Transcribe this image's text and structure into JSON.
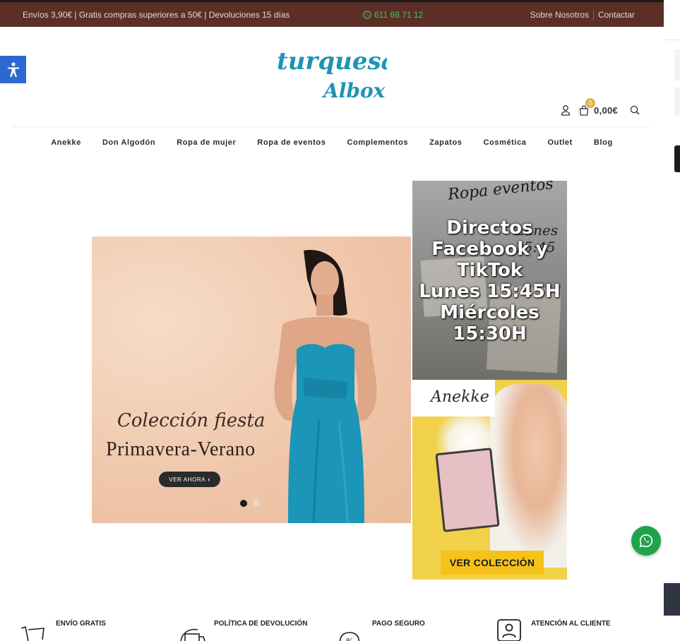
{
  "topbar": {
    "promo_text": "Envíos 3,90€ | Gratis compras superiores a 50€ | Devoluciones 15 días",
    "phone": "611 68 71 12",
    "links": [
      "Sobre Nosotros",
      "Contactar"
    ]
  },
  "logo": {
    "line1": "turquesa",
    "line2": "Albox"
  },
  "header": {
    "cart_count": "0",
    "cart_total": "0,00€"
  },
  "nav": [
    "Anekke",
    "Don Algodón",
    "Ropa de mujer",
    "Ropa de eventos",
    "Complementos",
    "Zapatos",
    "Cosmética",
    "Outlet",
    "Blog"
  ],
  "hero": {
    "title_script": "Colección fiesta",
    "title_serif": "Primavera-Verano",
    "button": "VER AHORA",
    "slides": 2,
    "active_slide": 1
  },
  "promo_live": {
    "script_top": "Ropa eventos",
    "script_side": "Lunes 15:45",
    "lines": [
      "Directos",
      "Facebook y",
      "TikTok",
      "Lunes 15:45H",
      "Miércoles",
      "15:30H"
    ]
  },
  "promo_anekke": {
    "brand": "Anekke",
    "cta": "VER COLECCIÓN"
  },
  "features": [
    {
      "title": "ENVÍO GRATIS",
      "icon": "cart-icon"
    },
    {
      "title": "POLÍTICA DE DEVOLUCIÓN",
      "icon": "return-truck-icon"
    },
    {
      "title": "PAGO SEGURO",
      "icon": "secure-payment-icon"
    },
    {
      "title": "ATENCIÓN AL CLIENTE",
      "icon": "customer-service-icon"
    }
  ],
  "colors": {
    "topbar_bg": "#5b2f26",
    "brand_teal": "#1d93b7",
    "whatsapp_green": "#1fa34a",
    "accessibility_blue": "#2e67cf"
  }
}
